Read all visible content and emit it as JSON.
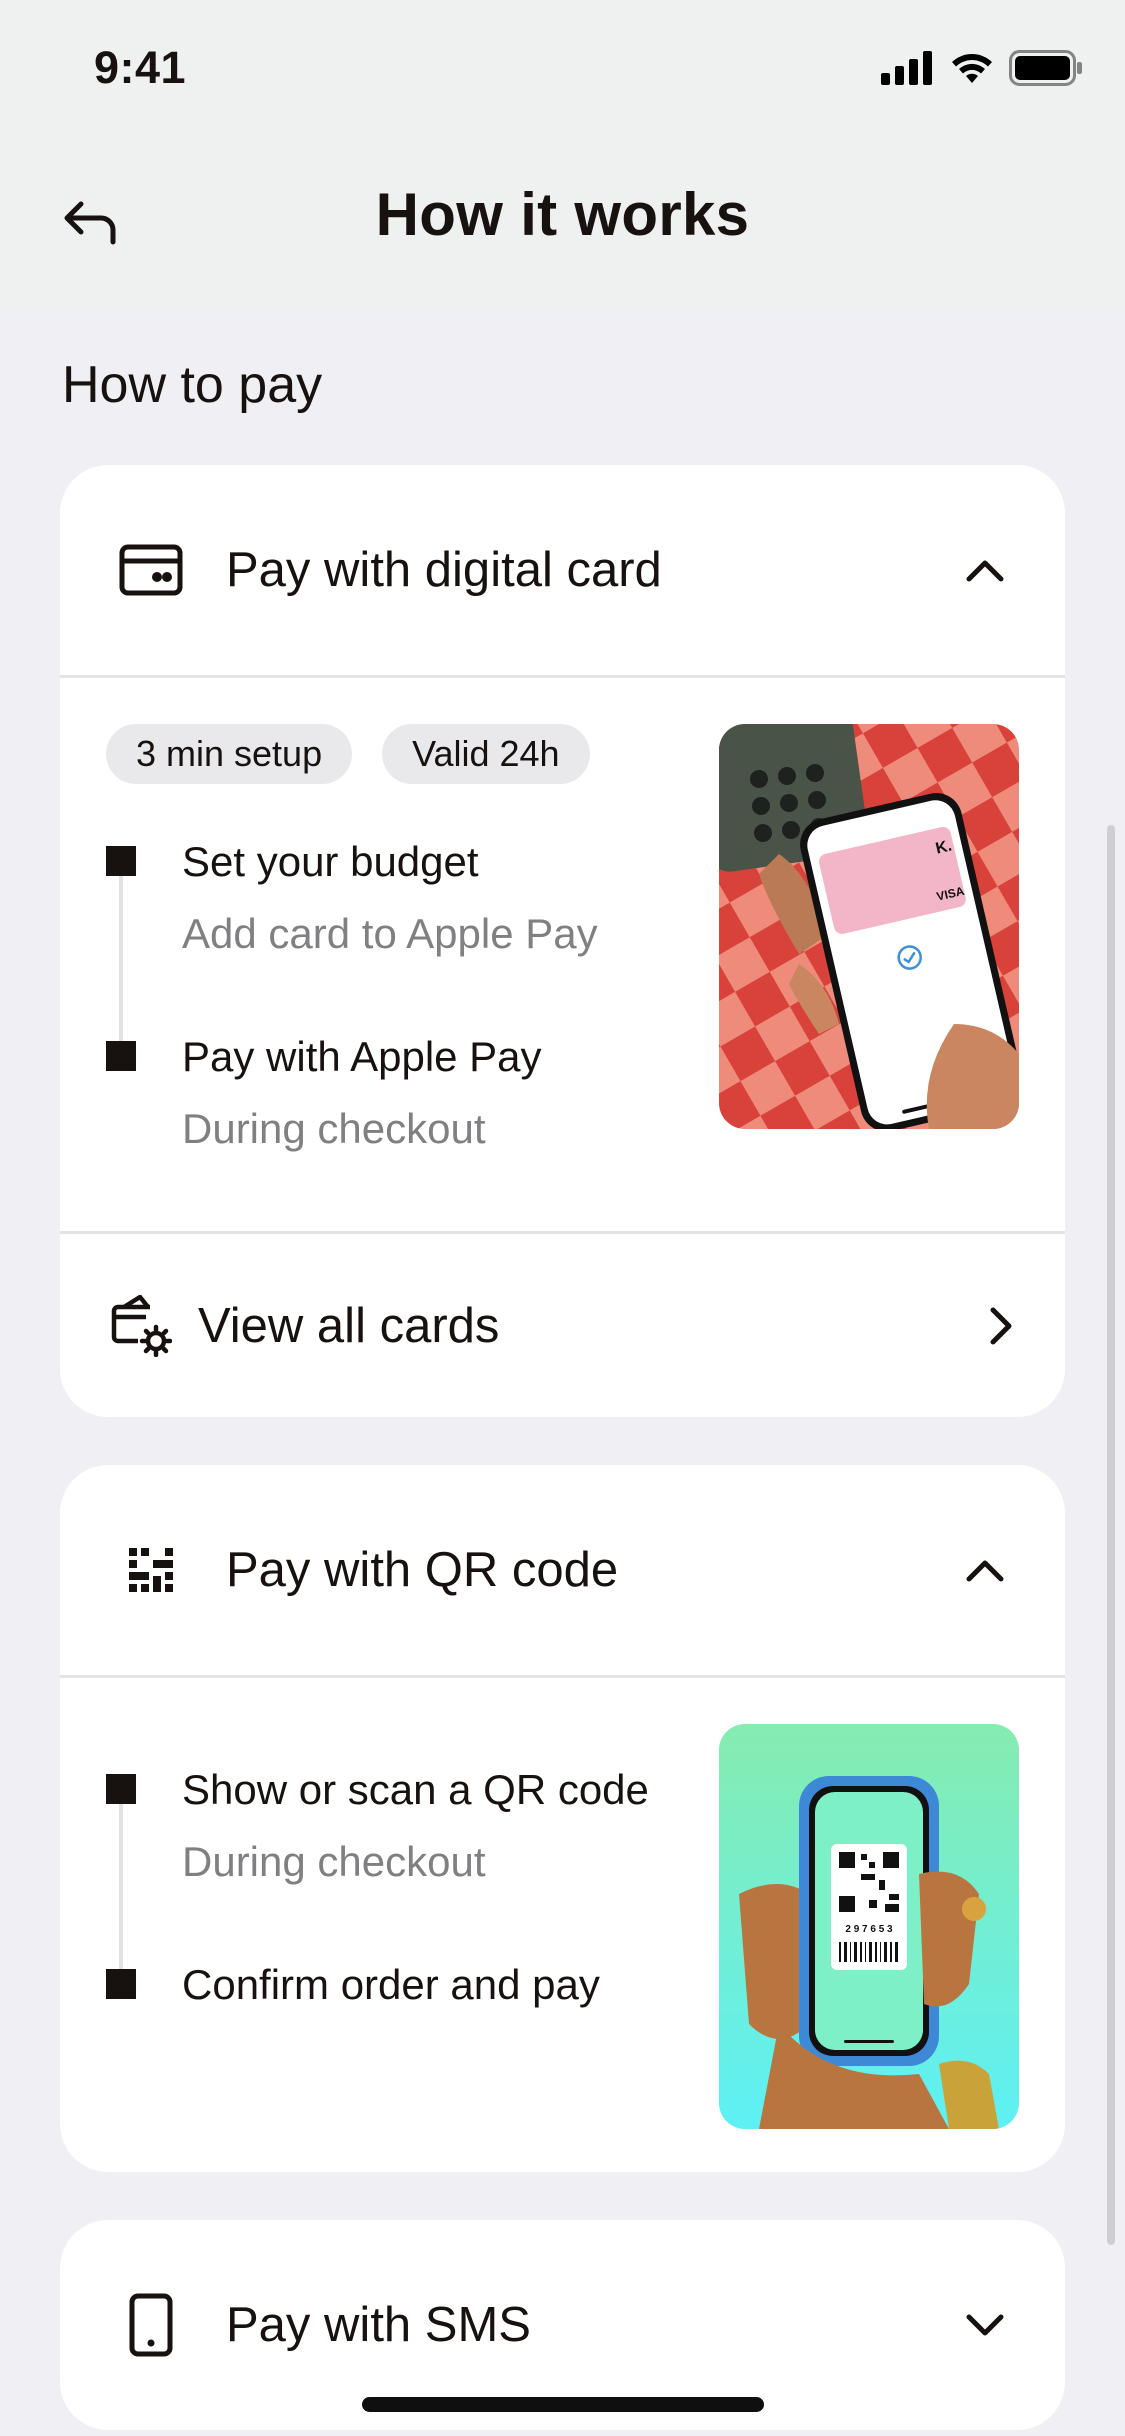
{
  "status_bar": {
    "time": "9:41"
  },
  "header": {
    "title": "How it works"
  },
  "section": {
    "title": "How to pay"
  },
  "digital_card": {
    "title": "Pay with digital card",
    "chips": [
      "3 min setup",
      "Valid 24h"
    ],
    "steps": [
      {
        "title": "Set your budget",
        "subtitle": "Add card to Apple Pay"
      },
      {
        "title": "Pay with Apple Pay",
        "subtitle": "During checkout"
      }
    ],
    "view_all_label": "View all cards"
  },
  "qr_code": {
    "title": "Pay with QR code",
    "steps": [
      {
        "title": "Show or scan a QR code",
        "subtitle": "During checkout"
      },
      {
        "title": "Confirm order and pay"
      }
    ],
    "photo_code": "2 9 7 6 5 3"
  },
  "sms": {
    "title": "Pay with SMS"
  },
  "colors": {
    "text": "#17120f",
    "muted": "#807f82",
    "background": "#f0f0f4",
    "card": "#ffffff"
  },
  "icons": [
    "back-arrow-icon",
    "card-icon",
    "chevron-up-icon",
    "card-settings-icon",
    "chevron-right-icon",
    "qr-code-icon",
    "phone-icon",
    "chevron-down-icon"
  ]
}
